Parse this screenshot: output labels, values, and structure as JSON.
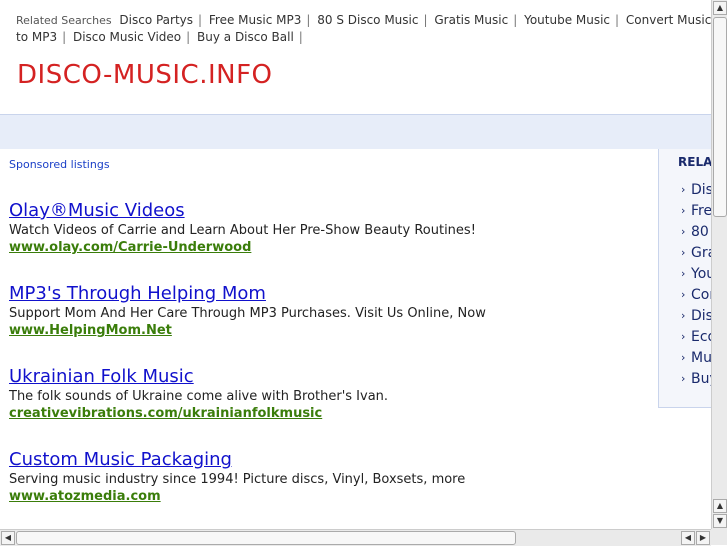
{
  "related": {
    "label": "Related Searches",
    "items": [
      "Disco Partys",
      "Free Music MP3",
      "80 S Disco Music",
      "Gratis Music",
      "Youtube Music",
      "Convert Music to MP3",
      "Disco Music Video",
      "Buy a Disco Ball"
    ]
  },
  "site_title": "DISCO-MUSIC.INFO",
  "sponsored_label": "Sponsored listings",
  "ads": [
    {
      "title": "Olay®Music Videos",
      "desc": "Watch Videos of Carrie and Learn About Her Pre-Show Beauty Routines!",
      "url": "www.olay.com/Carrie-Underwood"
    },
    {
      "title": "MP3's Through Helping Mom",
      "desc": "Support Mom And Her Care Through MP3 Purchases. Visit Us Online, Now",
      "url": "www.HelpingMom.Net"
    },
    {
      "title": "Ukrainian Folk Music",
      "desc": "The folk sounds of Ukraine come alive with Brother's Ivan.",
      "url": "creativevibrations.com/ukrainianfolkmusic"
    },
    {
      "title": "Custom Music Packaging",
      "desc": "Serving music industry since 1994! Picture discs, Vinyl, Boxsets, more",
      "url": "www.atozmedia.com"
    }
  ],
  "sidebar": {
    "heading": "RELAT",
    "items": [
      "Dis",
      "Fre",
      "80 S",
      "Gra",
      "You",
      "Con",
      "Dis",
      "Eco",
      "Mus",
      "Buy"
    ]
  },
  "scroll": {
    "up": "▲",
    "down": "▼",
    "left": "◀",
    "right": "▶"
  }
}
